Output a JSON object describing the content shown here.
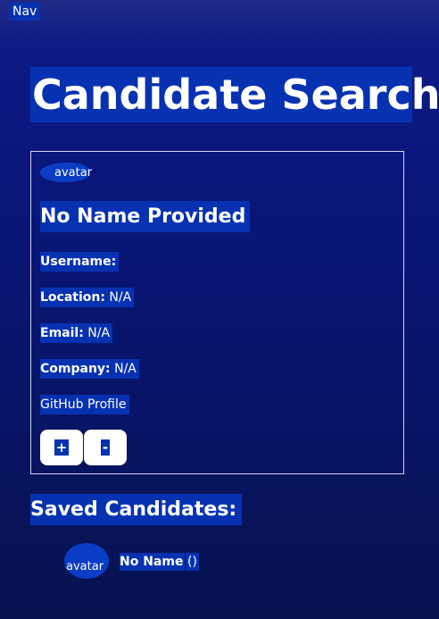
{
  "nav": {
    "label": "Nav"
  },
  "page": {
    "title": "Candidate Search"
  },
  "candidate": {
    "avatar_alt": "avatar",
    "name": "No Name Provided",
    "username_label": "Username:",
    "username_value": "",
    "location_label": "Location:",
    "location_value": "N/A",
    "email_label": "Email:",
    "email_value": "N/A",
    "company_label": "Company:",
    "company_value": "N/A",
    "profile_link": "GitHub Profile",
    "accept_label": "+",
    "reject_label": "-"
  },
  "saved": {
    "title": "Saved Candidates:",
    "items": [
      {
        "avatar_alt": "avatar",
        "name": "No Name",
        "extra": "()"
      }
    ]
  },
  "colors": {
    "highlight": "#0632b2",
    "background_top": "#1f2a86",
    "background_bottom": "#07124f",
    "card_border": "#cfd6ef"
  }
}
